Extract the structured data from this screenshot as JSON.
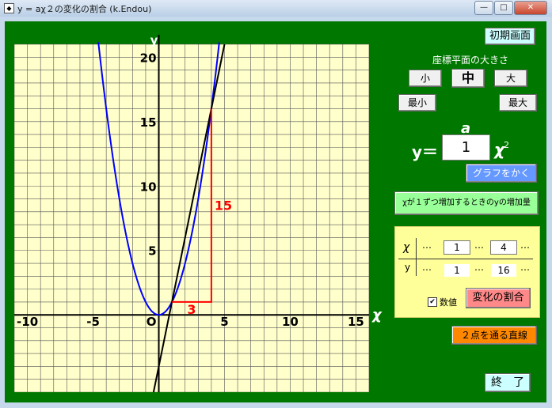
{
  "window": {
    "title": "y = aχ２の変化の割合 (k.Endou)",
    "app_icon": "window-icon",
    "controls": {
      "minimize": "—",
      "maximize": "□",
      "close": "✕"
    }
  },
  "colors": {
    "background": "#007800",
    "grid_bg": "#ffffcc",
    "curve": "#0000ff",
    "line": "#000000",
    "triangle": "#ff0000"
  },
  "buttons": {
    "initial_screen": "初期画面",
    "small": "小",
    "medium": "中",
    "large": "大",
    "smallest": "最小",
    "largest": "最大",
    "draw_graph": "グラフをかく",
    "increase": "χが１ずつ増加するときのyの増加量",
    "rate_of_change": "変化の割合",
    "line_through_points": "２点を通る直線",
    "end": "終　了"
  },
  "labels": {
    "plane_size": "座標平面の大きさ",
    "a_label": "a",
    "eq_y": "y＝",
    "eq_x": "χ",
    "eq_exp": "2",
    "a_value": "1",
    "x_row": "χ",
    "y_row": "y",
    "dots": "…",
    "numeric_checkbox": "数値"
  },
  "table": {
    "x1": "1",
    "x2": "4",
    "y1": "1",
    "y2": "16"
  },
  "checkbox_numeric_checked": true,
  "chart_data": {
    "type": "line",
    "xlabel": "χ",
    "ylabel": "y",
    "origin_label": "O",
    "xlim": [
      -11,
      16
    ],
    "ylim": [
      -6,
      21
    ],
    "grid": true,
    "x_tick_labels": [
      "-10",
      "-5",
      "5",
      "10",
      "15"
    ],
    "y_tick_labels": [
      "5",
      "10",
      "15",
      "20"
    ],
    "x_ticks": [
      -10,
      -5,
      5,
      10,
      15
    ],
    "y_ticks": [
      5,
      10,
      15,
      20
    ],
    "series": [
      {
        "kind": "parabola",
        "a": 1
      },
      {
        "kind": "line",
        "slope": 5,
        "intercept": -4,
        "through": [
          [
            1,
            1
          ],
          [
            4,
            16
          ]
        ]
      }
    ],
    "triangle": {
      "from": [
        1,
        1
      ],
      "corner": [
        4,
        1
      ],
      "to": [
        4,
        16
      ],
      "dx_label": "3",
      "dy_label": "15"
    }
  }
}
